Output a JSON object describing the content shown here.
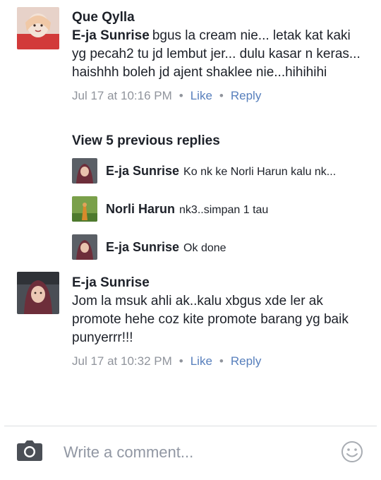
{
  "comments": [
    {
      "author": "Que Qylla",
      "mention": "E-ja Sunrise",
      "text": "bgus la cream nie...   letak kat kaki yg pecah2 tu jd lembut jer... dulu kasar n keras... haishhh boleh jd ajent shaklee nie...hihihihi",
      "time": "Jul 17 at 10:16 PM",
      "like": "Like",
      "reply": "Reply"
    },
    {
      "author": "E-ja Sunrise",
      "text": "Jom la msuk ahli ak..kalu xbgus xde ler ak promote hehe coz kite promote barang yg baik punyerrr!!!",
      "time": "Jul 17 at 10:32 PM",
      "like": "Like",
      "reply": "Reply"
    }
  ],
  "view_previous": "View 5 previous replies",
  "replies": [
    {
      "name": "E-ja Sunrise",
      "text": "Ko nk ke Norli Harun kalu nk..."
    },
    {
      "name": "Norli Harun",
      "text": "nk3..simpan 1 tau"
    },
    {
      "name": "E-ja Sunrise",
      "text": "Ok done"
    }
  ],
  "separator": "•",
  "composer": {
    "placeholder": "Write a comment..."
  },
  "icons": {
    "camera": "camera-icon",
    "emoji": "smiley-icon"
  },
  "colors": {
    "link": "#577fbc",
    "meta": "#90949c",
    "text": "#1d2129",
    "placeholder": "#9197a3"
  }
}
